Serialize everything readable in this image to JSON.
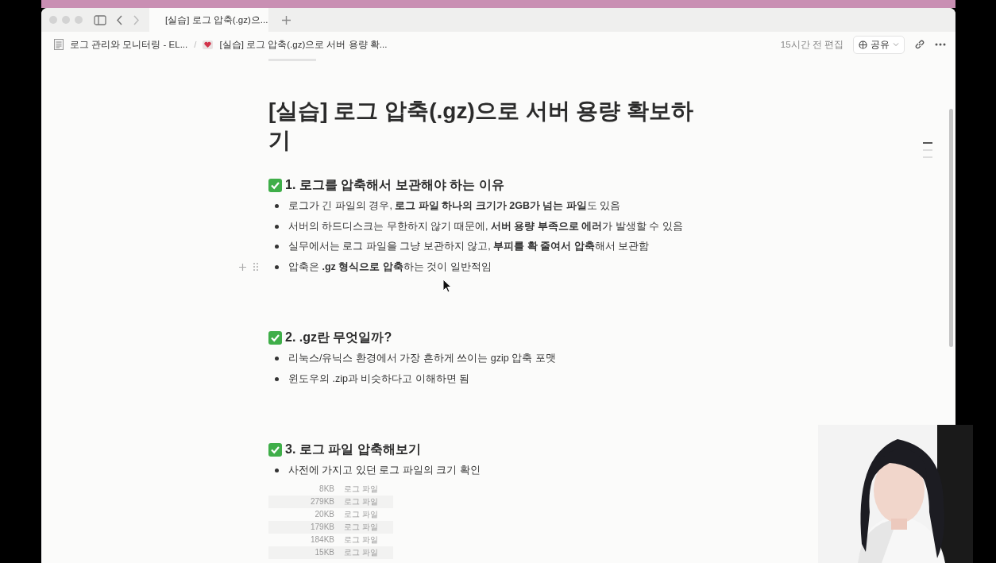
{
  "tab_bar": {
    "tabs": [
      {
        "title": "[실습] 로그 압축(.gz)으...",
        "selected": true
      }
    ]
  },
  "breadcrumb": {
    "separator": "/",
    "items": [
      {
        "label": "로그 관리와 모니터링 - EL...",
        "kind": "page"
      },
      {
        "label": "[실습] 로그 압축(.gz)으로 서버 용량 확...",
        "kind": "heart"
      }
    ]
  },
  "topbar": {
    "edited": "15시간 전 편집",
    "share": "공유"
  },
  "page": {
    "title": "[실습] 로그 압축(.gz)으로 서버 용량 확보하기",
    "sections": [
      {
        "heading": "1. 로그를 압축해서 보관해야 하는 이유",
        "bullets": [
          {
            "text": "로그가 긴 파일의 경우, **로그 파일 하나의 크기가 2GB가 넘는 파일**도 있음",
            "hovered": false
          },
          {
            "text": "서버의 하드디스크는 무한하지 않기 때문에, **서버 용량 부족으로 에러**가 발생할 수 있음",
            "hovered": false
          },
          {
            "text": "실무에서는 로그 파일을 그냥 보관하지 않고, **부피를 확 줄여서 압축**해서 보관함",
            "hovered": false
          },
          {
            "text": "압축은 **.gz 형식으로 압축**하는 것이 일반적임",
            "hovered": true
          }
        ]
      },
      {
        "heading": "2. .gz란 무엇일까?",
        "bullets": [
          {
            "text": "리눅스/유닉스 환경에서 가장 흔하게 쓰이는 gzip 압축 포맷",
            "hovered": false
          },
          {
            "text": "윈도우의 .zip과 비슷하다고 이해하면 됨",
            "hovered": false
          }
        ]
      },
      {
        "heading": "3. 로그 파일 압축해보기",
        "bullets": [
          {
            "text": "사전에 가지고 있던 로그 파일의 크기 확인",
            "hovered": false
          }
        ]
      }
    ],
    "file_list": [
      {
        "size": "8KB",
        "name": "로그 파일"
      },
      {
        "size": "279KB",
        "name": "로그 파일"
      },
      {
        "size": "20KB",
        "name": "로그 파일"
      },
      {
        "size": "179KB",
        "name": "로그 파일"
      },
      {
        "size": "184KB",
        "name": "로그 파일"
      },
      {
        "size": "15KB",
        "name": "로그 파일"
      }
    ]
  }
}
